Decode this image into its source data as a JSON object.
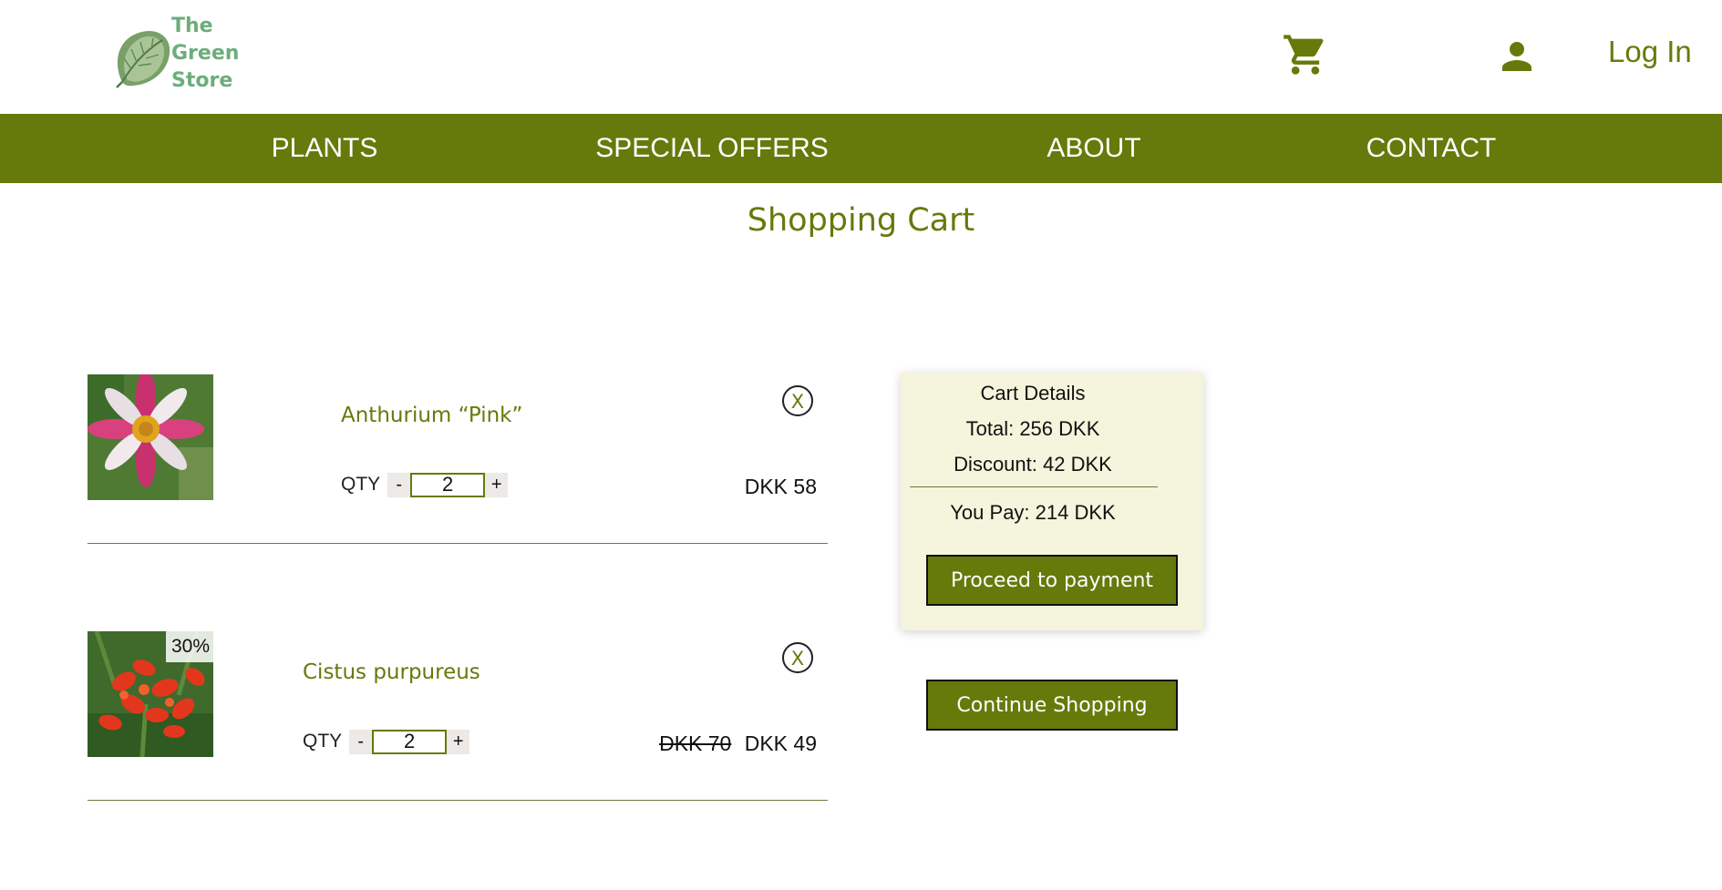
{
  "header": {
    "logo_text": "The Green Store",
    "login_label": "Log In",
    "cart_icon": "shopping-cart-icon",
    "user_icon": "user-icon"
  },
  "nav": {
    "items": [
      {
        "label": "PLANTS"
      },
      {
        "label": "SPECIAL OFFERS"
      },
      {
        "label": "ABOUT"
      },
      {
        "label": "CONTACT"
      }
    ]
  },
  "page": {
    "title": "Shopping Cart"
  },
  "cart": {
    "qty_label": "QTY",
    "minus_label": "-",
    "plus_label": "+",
    "remove_label": "X",
    "items": [
      {
        "name": "Anthurium “Pink”",
        "qty": "2",
        "price": "DKK 58",
        "old_price": "",
        "discount_badge": ""
      },
      {
        "name": "Cistus purpureus",
        "qty": "2",
        "price": "DKK 49",
        "old_price": "DKK 70",
        "discount_badge": "30%"
      }
    ]
  },
  "details": {
    "title": "Cart Details",
    "total": "Total: 256  DKK",
    "discount": "Discount: 42  DKK",
    "you_pay": "You Pay: 214  DKK",
    "pay_button": "Proceed to payment"
  },
  "continue_button": "Continue Shopping",
  "colors": {
    "brand_green": "#657a0b",
    "logo_green": "#6dad7b",
    "details_bg": "#f4f5dc"
  }
}
